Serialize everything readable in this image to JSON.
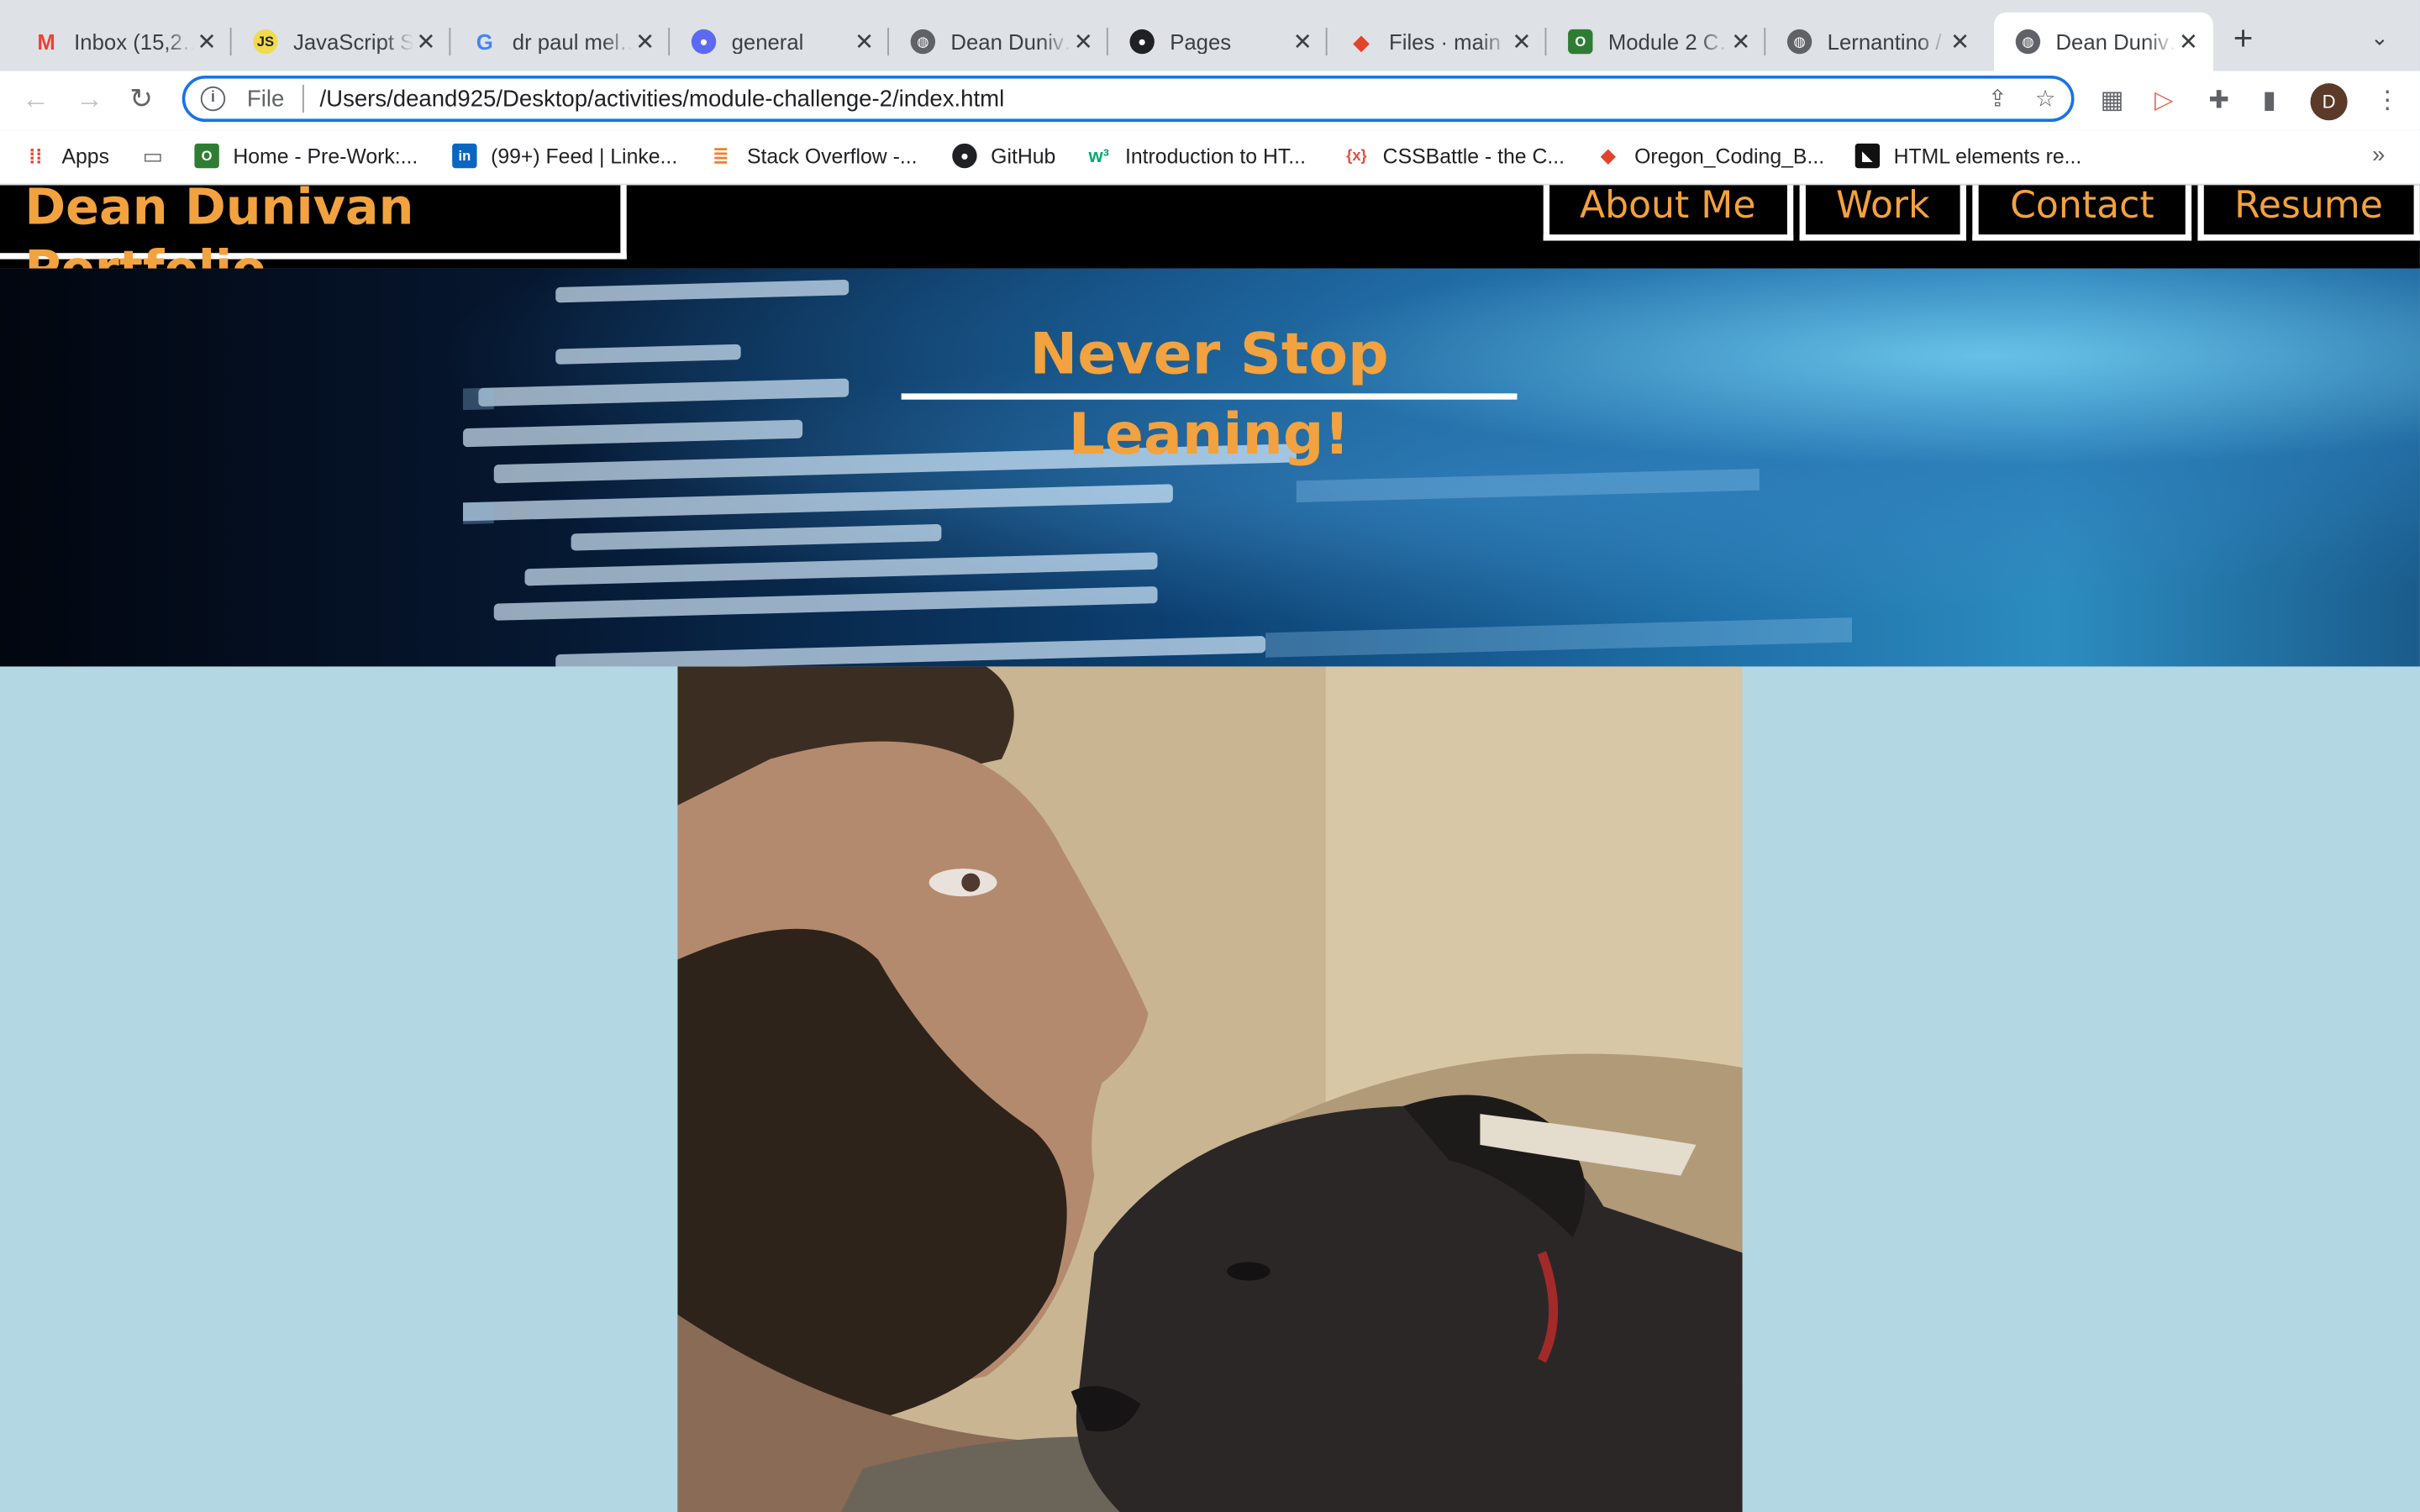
{
  "browser": {
    "tabs": [
      {
        "title": "Inbox (15,2…",
        "icon": "gmail-icon",
        "color": "#ea4335"
      },
      {
        "title": "JavaScript S…",
        "icon": "js-icon",
        "color": "#f0db4f"
      },
      {
        "title": "dr paul mel…",
        "icon": "google-icon",
        "color": "#4285f4"
      },
      {
        "title": "general",
        "icon": "chat-icon",
        "color": "#5b6af0"
      },
      {
        "title": "Dean Duniv…",
        "icon": "globe-icon",
        "color": "#5f6368"
      },
      {
        "title": "Pages",
        "icon": "github-icon",
        "color": "#202124"
      },
      {
        "title": "Files · main",
        "icon": "gitlab-icon",
        "color": "#e24329"
      },
      {
        "title": "Module 2 C…",
        "icon": "module-icon",
        "color": "#2e7d32"
      },
      {
        "title": "Lernantino /",
        "icon": "globe-icon",
        "color": "#5f6368"
      },
      {
        "title": "Dean Duniv…",
        "icon": "globe-icon",
        "color": "#5f6368",
        "active": true
      }
    ],
    "address": {
      "scheme": "File",
      "path": "/Users/deand925/Desktop/activities/module-challenge-2/index.html"
    },
    "profile_initial": "D",
    "bookmarks": [
      {
        "label": "Apps",
        "icon": "apps-grid-icon"
      },
      {
        "label": "",
        "icon": "folder-icon"
      },
      {
        "label": "Home - Pre-Work:...",
        "icon": "module-icon"
      },
      {
        "label": "(99+) Feed | Linke...",
        "icon": "linkedin-icon"
      },
      {
        "label": "Stack Overflow -...",
        "icon": "stackoverflow-icon"
      },
      {
        "label": "GitHub",
        "icon": "github-icon"
      },
      {
        "label": "Introduction to HT...",
        "icon": "w3-icon"
      },
      {
        "label": "CSSBattle - the C...",
        "icon": "cssbattle-icon"
      },
      {
        "label": "Oregon_Coding_B...",
        "icon": "gitlab-icon"
      },
      {
        "label": "HTML elements re...",
        "icon": "mdn-icon"
      }
    ]
  },
  "site": {
    "title": "Dean Dunivan Portfolio",
    "nav": [
      "About Me",
      "Work",
      "Contact",
      "Resume"
    ],
    "hero_heading": "Never Stop Leaning!",
    "accent_color": "#f2a23e",
    "background_color": "#b4d7e4"
  }
}
